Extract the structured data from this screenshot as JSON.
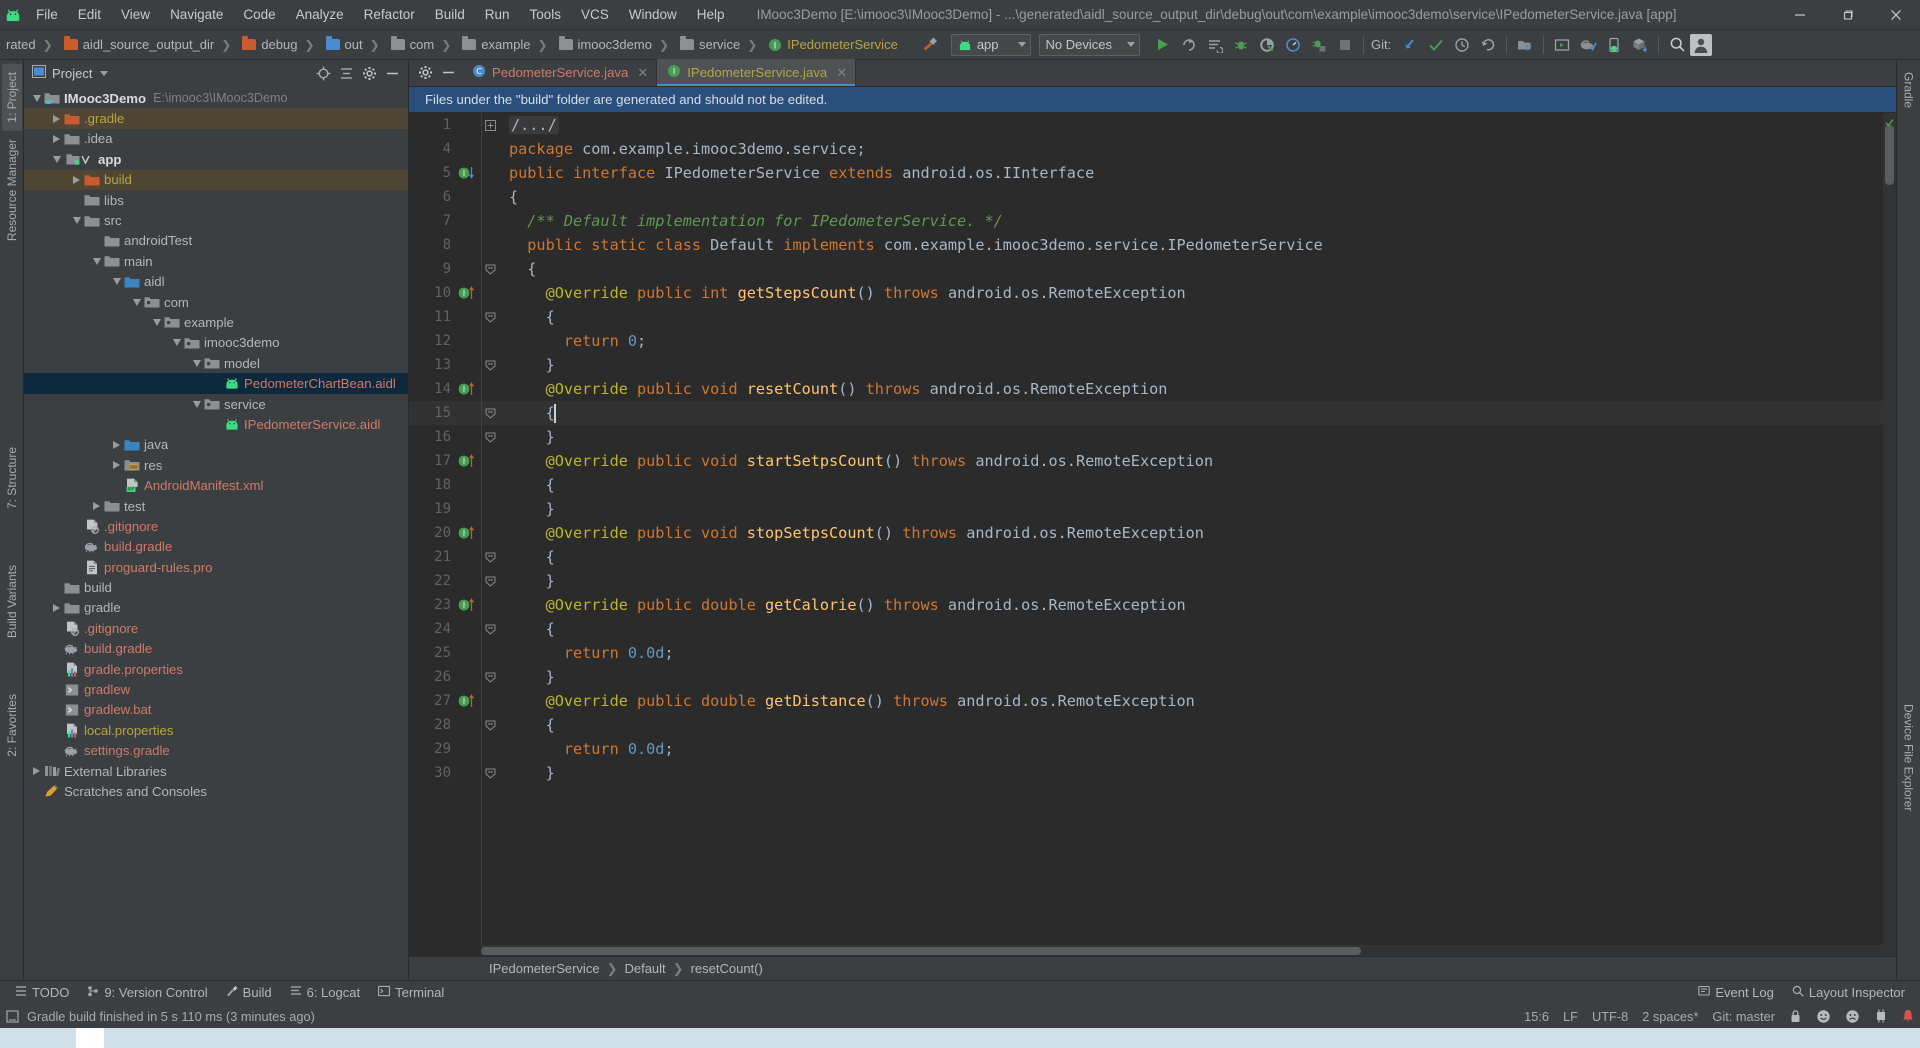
{
  "window": {
    "title": "IMooc3Demo [E:\\imooc3\\IMooc3Demo] - ...\\generated\\aidl_source_output_dir\\debug\\out\\com\\example\\imooc3demo\\service\\IPedometerService.java [app]",
    "minimize": "—",
    "maximize": "❐",
    "close": "✕",
    "logo_icon": "android-logo-icon"
  },
  "menubar": [
    {
      "label": "File"
    },
    {
      "label": "Edit"
    },
    {
      "label": "View"
    },
    {
      "label": "Navigate"
    },
    {
      "label": "Code"
    },
    {
      "label": "Analyze"
    },
    {
      "label": "Refactor"
    },
    {
      "label": "Build"
    },
    {
      "label": "Run"
    },
    {
      "label": "Tools"
    },
    {
      "label": "VCS"
    },
    {
      "label": "Window"
    },
    {
      "label": "Help"
    }
  ],
  "navbar": {
    "breadcrumbs": [
      {
        "label": "rated",
        "icon": "none"
      },
      {
        "label": "aidl_source_output_dir",
        "icon": "folder-orange"
      },
      {
        "label": "debug",
        "icon": "folder-orange"
      },
      {
        "label": "out",
        "icon": "folder-blue-gear"
      },
      {
        "label": "com",
        "icon": "package"
      },
      {
        "label": "example",
        "icon": "package"
      },
      {
        "label": "imooc3demo",
        "icon": "package"
      },
      {
        "label": "service",
        "icon": "package"
      },
      {
        "label": "IPedometerService",
        "icon": "interface-green"
      }
    ],
    "run_config": "app",
    "device": "No Devices",
    "git_label": "Git:",
    "icons": [
      "hammer-build-icon",
      "run-icon",
      "rerun-icon",
      "apply-changes-icon",
      "debug-icon",
      "coverage-icon",
      "profiler-icon",
      "attach-debugger-icon",
      "stop-icon",
      "update-project-icon",
      "commit-icon",
      "history-icon",
      "undo-icon",
      "project-structure-icon",
      "avd-manager-icon",
      "sdk-manager-icon",
      "device-manager-icon",
      "build-variants-icon",
      "search-icon",
      "profile-icon"
    ]
  },
  "left_tool_tabs": [
    {
      "label": "1: Project",
      "active": true
    },
    {
      "label": "Resource Manager",
      "active": false
    },
    {
      "label": "7: Structure",
      "active": false
    },
    {
      "label": "Build Variants",
      "active": false
    },
    {
      "label": "2: Favorites",
      "active": false
    }
  ],
  "right_tool_tabs": [
    {
      "label": "Gradle"
    },
    {
      "label": "Device File Explorer"
    }
  ],
  "project_panel": {
    "title": "Project",
    "actions": [
      "target-icon",
      "collapse-all-icon",
      "settings-icon",
      "hide-icon"
    ],
    "tree": [
      {
        "indent": 0,
        "twist": "down",
        "icon": "project-root",
        "label": "IMooc3Demo",
        "sub": "E:\\imooc3\\IMooc3Demo",
        "color": "#d8dadc",
        "bold": true
      },
      {
        "indent": 1,
        "twist": "right",
        "icon": "folder-orange",
        "label": ".gradle",
        "color": "#b5a642",
        "highlight": true
      },
      {
        "indent": 1,
        "twist": "right",
        "icon": "folder-gray",
        "label": ".idea",
        "color": "#b4b7b9"
      },
      {
        "indent": 1,
        "twist": "down",
        "icon": "module-app",
        "label": "app",
        "color": "#d8dadc",
        "bold": true
      },
      {
        "indent": 2,
        "twist": "right",
        "icon": "folder-orange",
        "label": "build",
        "color": "#b5a642",
        "highlight": true
      },
      {
        "indent": 2,
        "twist": "none",
        "icon": "folder-gray",
        "label": "libs",
        "color": "#b4b7b9"
      },
      {
        "indent": 2,
        "twist": "down",
        "icon": "folder-gray",
        "label": "src",
        "color": "#b4b7b9"
      },
      {
        "indent": 3,
        "twist": "none",
        "icon": "folder-gray",
        "label": "androidTest",
        "color": "#b4b7b9"
      },
      {
        "indent": 3,
        "twist": "down",
        "icon": "folder-gray",
        "label": "main",
        "color": "#b4b7b9"
      },
      {
        "indent": 4,
        "twist": "down",
        "icon": "folder-blue",
        "label": "aidl",
        "color": "#b4b7b9"
      },
      {
        "indent": 5,
        "twist": "down",
        "icon": "package",
        "label": "com",
        "color": "#b4b7b9"
      },
      {
        "indent": 6,
        "twist": "down",
        "icon": "package",
        "label": "example",
        "color": "#b4b7b9"
      },
      {
        "indent": 7,
        "twist": "down",
        "icon": "package",
        "label": "imooc3demo",
        "color": "#b4b7b9"
      },
      {
        "indent": 8,
        "twist": "down",
        "icon": "package",
        "label": "model",
        "color": "#b4b7b9"
      },
      {
        "indent": 9,
        "twist": "none",
        "icon": "aidl-file",
        "label": "PedometerChartBean.aidl",
        "color": "#cf7a6a",
        "selected": true
      },
      {
        "indent": 8,
        "twist": "down",
        "icon": "package",
        "label": "service",
        "color": "#b4b7b9"
      },
      {
        "indent": 9,
        "twist": "none",
        "icon": "aidl-file",
        "label": "IPedometerService.aidl",
        "color": "#cf7a6a"
      },
      {
        "indent": 4,
        "twist": "right",
        "icon": "folder-blue",
        "label": "java",
        "color": "#b4b7b9"
      },
      {
        "indent": 4,
        "twist": "right",
        "icon": "folder-res",
        "label": "res",
        "color": "#b4b7b9"
      },
      {
        "indent": 4,
        "twist": "none",
        "icon": "manifest-file",
        "label": "AndroidManifest.xml",
        "color": "#cf7a6a"
      },
      {
        "indent": 3,
        "twist": "right",
        "icon": "folder-gray",
        "label": "test",
        "color": "#b4b7b9"
      },
      {
        "indent": 2,
        "twist": "none",
        "icon": "gitignore-file",
        "label": ".gitignore",
        "color": "#cf7a6a"
      },
      {
        "indent": 2,
        "twist": "none",
        "icon": "gradle-file",
        "label": "build.gradle",
        "color": "#cf7a6a"
      },
      {
        "indent": 2,
        "twist": "none",
        "icon": "text-file",
        "label": "proguard-rules.pro",
        "color": "#cf7a6a"
      },
      {
        "indent": 1,
        "twist": "none",
        "icon": "folder-gray",
        "label": "build",
        "color": "#b4b7b9"
      },
      {
        "indent": 1,
        "twist": "right",
        "icon": "folder-gray",
        "label": "gradle",
        "color": "#b4b7b9"
      },
      {
        "indent": 1,
        "twist": "none",
        "icon": "gitignore-file",
        "label": ".gitignore",
        "color": "#cf7a6a"
      },
      {
        "indent": 1,
        "twist": "none",
        "icon": "gradle-file",
        "label": "build.gradle",
        "color": "#cf7a6a"
      },
      {
        "indent": 1,
        "twist": "none",
        "icon": "properties-file",
        "label": "gradle.properties",
        "color": "#cf7a6a"
      },
      {
        "indent": 1,
        "twist": "none",
        "icon": "script-file",
        "label": "gradlew",
        "color": "#cf7a6a"
      },
      {
        "indent": 1,
        "twist": "none",
        "icon": "script-file",
        "label": "gradlew.bat",
        "color": "#cf7a6a"
      },
      {
        "indent": 1,
        "twist": "none",
        "icon": "properties-file",
        "label": "local.properties",
        "color": "#b5a642"
      },
      {
        "indent": 1,
        "twist": "none",
        "icon": "gradle-file",
        "label": "settings.gradle",
        "color": "#cf7a6a"
      },
      {
        "indent": 0,
        "twist": "right",
        "icon": "libraries",
        "label": "External Libraries",
        "color": "#b4b7b9"
      },
      {
        "indent": 0,
        "twist": "none",
        "icon": "scratches",
        "label": "Scratches and Consoles",
        "color": "#b4b7b9"
      }
    ]
  },
  "editor": {
    "tabs": [
      {
        "label": "PedometerService.java",
        "icon": "class-icon",
        "active": false,
        "closable": true
      },
      {
        "label": "IPedometerService.java",
        "icon": "interface-icon",
        "active": true,
        "closable": true
      }
    ],
    "notice": "Files under the \"build\" folder are generated and should not be edited.",
    "lines": [
      {
        "num": "1",
        "fold": "+",
        "gutter": "",
        "segs": [
          {
            "t": "/.../",
            "c": "fold1"
          }
        ]
      },
      {
        "num": "4",
        "fold": "",
        "gutter": "",
        "segs": [
          {
            "t": "package ",
            "c": "k"
          },
          {
            "t": "com.example.imooc3demo.service;",
            "c": "t"
          }
        ]
      },
      {
        "num": "5",
        "fold": "",
        "gutter": "impl-down",
        "segs": [
          {
            "t": "public interface ",
            "c": "k"
          },
          {
            "t": "IPedometerService ",
            "c": "t"
          },
          {
            "t": "extends ",
            "c": "k"
          },
          {
            "t": "android.os.IInterface",
            "c": "t"
          }
        ]
      },
      {
        "num": "6",
        "fold": "",
        "gutter": "",
        "segs": [
          {
            "t": "{",
            "c": "t"
          }
        ]
      },
      {
        "num": "7",
        "fold": "",
        "gutter": "",
        "segs": [
          {
            "t": "  /** Default implementation for IPedometerService. */",
            "c": "cm"
          }
        ]
      },
      {
        "num": "8",
        "fold": "",
        "gutter": "",
        "segs": [
          {
            "t": "  public static class ",
            "c": "k"
          },
          {
            "t": "Default ",
            "c": "t"
          },
          {
            "t": "implements ",
            "c": "k"
          },
          {
            "t": "com.example.imooc3demo.service.IPedometerService",
            "c": "t"
          }
        ]
      },
      {
        "num": "9",
        "fold": "-",
        "gutter": "",
        "segs": [
          {
            "t": "  {",
            "c": "t"
          }
        ]
      },
      {
        "num": "10",
        "fold": "",
        "gutter": "impl-up",
        "segs": [
          {
            "t": "    @Override ",
            "c": "an"
          },
          {
            "t": "public int ",
            "c": "k"
          },
          {
            "t": "getStepsCount",
            "c": "fn"
          },
          {
            "t": "() ",
            "c": "t"
          },
          {
            "t": "throws ",
            "c": "k"
          },
          {
            "t": "android.os.RemoteException",
            "c": "t"
          }
        ]
      },
      {
        "num": "11",
        "fold": "-",
        "gutter": "",
        "segs": [
          {
            "t": "    {",
            "c": "t"
          }
        ]
      },
      {
        "num": "12",
        "fold": "",
        "gutter": "",
        "segs": [
          {
            "t": "      return ",
            "c": "k"
          },
          {
            "t": "0",
            "c": "nu"
          },
          {
            "t": ";",
            "c": "t"
          }
        ]
      },
      {
        "num": "13",
        "fold": "-",
        "gutter": "",
        "segs": [
          {
            "t": "    }",
            "c": "t"
          }
        ]
      },
      {
        "num": "14",
        "fold": "",
        "gutter": "impl-up",
        "segs": [
          {
            "t": "    @Override ",
            "c": "an"
          },
          {
            "t": "public void ",
            "c": "k"
          },
          {
            "t": "resetCount",
            "c": "fn"
          },
          {
            "t": "() ",
            "c": "t"
          },
          {
            "t": "throws ",
            "c": "k"
          },
          {
            "t": "android.os.RemoteException",
            "c": "t"
          }
        ]
      },
      {
        "num": "15",
        "fold": "-",
        "gutter": "",
        "caret": true,
        "segs": [
          {
            "t": "    {",
            "c": "t"
          }
        ]
      },
      {
        "num": "16",
        "fold": "-",
        "gutter": "",
        "segs": [
          {
            "t": "    }",
            "c": "t"
          }
        ]
      },
      {
        "num": "17",
        "fold": "",
        "gutter": "impl-up",
        "segs": [
          {
            "t": "    @Override ",
            "c": "an"
          },
          {
            "t": "public void ",
            "c": "k"
          },
          {
            "t": "startSetpsCount",
            "c": "fn"
          },
          {
            "t": "() ",
            "c": "t"
          },
          {
            "t": "throws ",
            "c": "k"
          },
          {
            "t": "android.os.RemoteException",
            "c": "t"
          }
        ]
      },
      {
        "num": "18",
        "fold": "",
        "gutter": "",
        "segs": [
          {
            "t": "    {",
            "c": "t"
          }
        ]
      },
      {
        "num": "19",
        "fold": "",
        "gutter": "",
        "segs": [
          {
            "t": "    }",
            "c": "t"
          }
        ]
      },
      {
        "num": "20",
        "fold": "",
        "gutter": "impl-up",
        "segs": [
          {
            "t": "    @Override ",
            "c": "an"
          },
          {
            "t": "public void ",
            "c": "k"
          },
          {
            "t": "stopSetpsCount",
            "c": "fn"
          },
          {
            "t": "() ",
            "c": "t"
          },
          {
            "t": "throws ",
            "c": "k"
          },
          {
            "t": "android.os.RemoteException",
            "c": "t"
          }
        ]
      },
      {
        "num": "21",
        "fold": "-",
        "gutter": "",
        "segs": [
          {
            "t": "    {",
            "c": "t"
          }
        ]
      },
      {
        "num": "22",
        "fold": "-",
        "gutter": "",
        "segs": [
          {
            "t": "    }",
            "c": "t"
          }
        ]
      },
      {
        "num": "23",
        "fold": "",
        "gutter": "impl-up",
        "segs": [
          {
            "t": "    @Override ",
            "c": "an"
          },
          {
            "t": "public double ",
            "c": "k"
          },
          {
            "t": "getCalorie",
            "c": "fn"
          },
          {
            "t": "() ",
            "c": "t"
          },
          {
            "t": "throws ",
            "c": "k"
          },
          {
            "t": "android.os.RemoteException",
            "c": "t"
          }
        ]
      },
      {
        "num": "24",
        "fold": "-",
        "gutter": "",
        "segs": [
          {
            "t": "    {",
            "c": "t"
          }
        ]
      },
      {
        "num": "25",
        "fold": "",
        "gutter": "",
        "segs": [
          {
            "t": "      return ",
            "c": "k"
          },
          {
            "t": "0.0d",
            "c": "nu"
          },
          {
            "t": ";",
            "c": "t"
          }
        ]
      },
      {
        "num": "26",
        "fold": "-",
        "gutter": "",
        "segs": [
          {
            "t": "    }",
            "c": "t"
          }
        ]
      },
      {
        "num": "27",
        "fold": "",
        "gutter": "impl-up",
        "segs": [
          {
            "t": "    @Override ",
            "c": "an"
          },
          {
            "t": "public double ",
            "c": "k"
          },
          {
            "t": "getDistance",
            "c": "fn"
          },
          {
            "t": "() ",
            "c": "t"
          },
          {
            "t": "throws ",
            "c": "k"
          },
          {
            "t": "android.os.RemoteException",
            "c": "t"
          }
        ]
      },
      {
        "num": "28",
        "fold": "-",
        "gutter": "",
        "segs": [
          {
            "t": "    {",
            "c": "t"
          }
        ]
      },
      {
        "num": "29",
        "fold": "",
        "gutter": "",
        "segs": [
          {
            "t": "      return ",
            "c": "k"
          },
          {
            "t": "0.0d",
            "c": "nu"
          },
          {
            "t": ";",
            "c": "t"
          }
        ]
      },
      {
        "num": "30",
        "fold": "-",
        "gutter": "",
        "segs": [
          {
            "t": "    }",
            "c": "t"
          }
        ]
      }
    ],
    "breadcrumb": [
      "IPedometerService",
      "Default",
      "resetCount()"
    ]
  },
  "tool_window_bar": {
    "left": [
      {
        "label": "TODO",
        "icon": "todo-icon"
      },
      {
        "label": "9: Version Control",
        "icon": "vcs-icon"
      },
      {
        "label": "Build",
        "icon": "build-icon"
      },
      {
        "label": "6: Logcat",
        "icon": "logcat-icon"
      },
      {
        "label": "Terminal",
        "icon": "terminal-icon"
      }
    ],
    "right": [
      {
        "label": "Event Log",
        "icon": "event-log-icon"
      },
      {
        "label": "Layout Inspector",
        "icon": "layout-inspector-icon"
      }
    ]
  },
  "statusbar": {
    "message": "Gradle build finished in 5 s 110 ms (3 minutes ago)",
    "caret_position": "15:6",
    "line_separator": "LF",
    "encoding": "UTF-8",
    "indent": "2 spaces*",
    "git_branch": "Git: master",
    "icons": [
      "lock-icon",
      "happy-face-icon",
      "sad-face-icon",
      "memory-icon",
      "notification-icon"
    ]
  },
  "colors": {
    "chrome": "#3c3f41",
    "editor_bg": "#2b2b2b",
    "gutter_bg": "#313335",
    "accent_blue": "#2a4f7c",
    "selection": "#0d293e",
    "keyword": "#cc7832",
    "comment": "#629755",
    "annotation": "#bbb529",
    "method": "#ffc66d",
    "number": "#6897bb",
    "string_red": "#cf7a6a",
    "yellow": "#b5a642",
    "green": "#499c54"
  }
}
